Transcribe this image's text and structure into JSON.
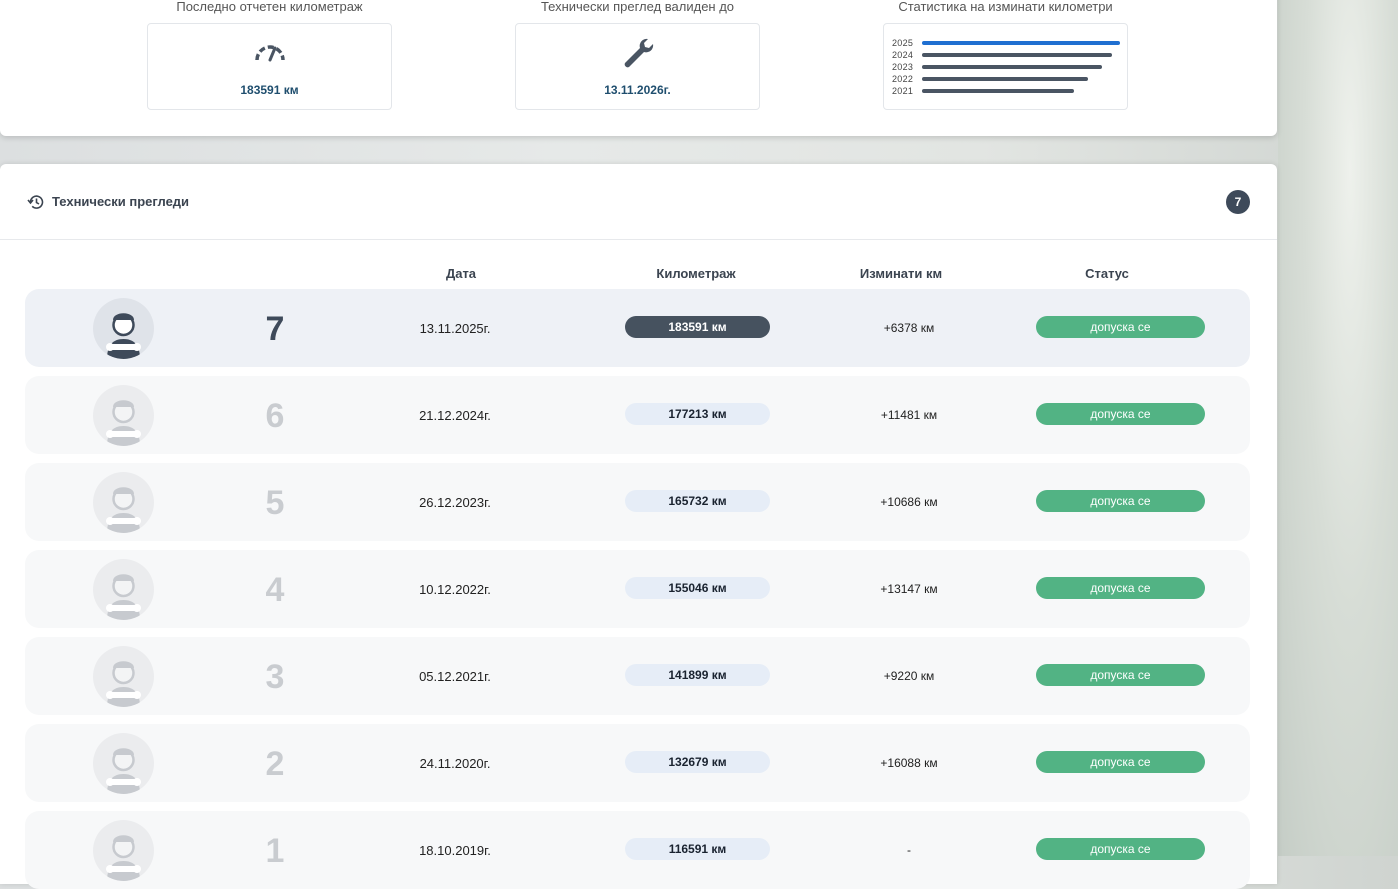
{
  "summary": {
    "mileage": {
      "label": "Последно отчетен километраж",
      "value": "183591 км",
      "icon": "speedometer-icon"
    },
    "inspection": {
      "label": "Технически преглед валиден до",
      "value": "13.11.2026г.",
      "icon": "wrench-icon"
    },
    "stats": {
      "label": "Статистика на изминати километри",
      "years": [
        {
          "year": "2025",
          "level": 1.0,
          "color": "#1f6fd1"
        },
        {
          "year": "2024",
          "level": 0.96,
          "color": "#4a5563"
        },
        {
          "year": "2023",
          "level": 0.91,
          "color": "#4a5563"
        },
        {
          "year": "2022",
          "level": 0.84,
          "color": "#4a5563"
        },
        {
          "year": "2021",
          "level": 0.77,
          "color": "#4a5563"
        }
      ]
    }
  },
  "inspections": {
    "title": "Технически прегледи",
    "count": "7",
    "columns": {
      "date": "Дата",
      "km": "Километраж",
      "diff": "Изминати км",
      "status": "Статус"
    },
    "rows": [
      {
        "num": "7",
        "date": "13.11.2025г.",
        "km": "183591 км",
        "diff": "+6378 км",
        "status": "допуска се"
      },
      {
        "num": "6",
        "date": "21.12.2024г.",
        "km": "177213 км",
        "diff": "+11481 км",
        "status": "допуска се"
      },
      {
        "num": "5",
        "date": "26.12.2023г.",
        "km": "165732 км",
        "diff": "+10686 км",
        "status": "допуска се"
      },
      {
        "num": "4",
        "date": "10.12.2022г.",
        "km": "155046 км",
        "diff": "+13147 км",
        "status": "допуска се"
      },
      {
        "num": "3",
        "date": "05.12.2021г.",
        "km": "141899 км",
        "diff": "+9220 км",
        "status": "допуска се"
      },
      {
        "num": "2",
        "date": "24.11.2020г.",
        "km": "132679 км",
        "diff": "+16088 км",
        "status": "допуска се"
      },
      {
        "num": "1",
        "date": "18.10.2019г.",
        "km": "116591 км",
        "diff": "-",
        "status": "допуска се"
      }
    ]
  },
  "colors": {
    "accent": "#1f6fd1",
    "status_ok": "#52b384",
    "dark": "#3e4a5a"
  }
}
